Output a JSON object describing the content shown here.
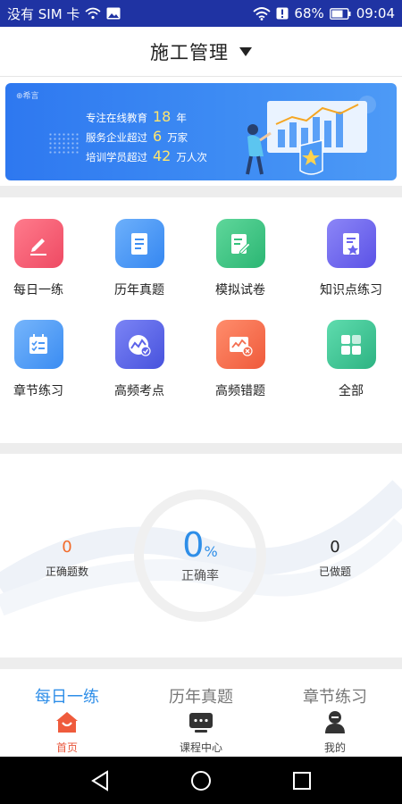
{
  "status_bar": {
    "carrier": "没有 SIM 卡",
    "battery": "68%",
    "time": "09:04"
  },
  "header": {
    "title": "施工管理"
  },
  "banner": {
    "logo_text": "⊕希言",
    "lines": [
      {
        "prefix": "专注在线教育",
        "num": "18",
        "suffix": "年"
      },
      {
        "prefix": "服务企业超过",
        "num": "6",
        "suffix": "万家"
      },
      {
        "prefix": "培训学员超过",
        "num": "42",
        "suffix": "万人次"
      }
    ]
  },
  "grid": [
    {
      "label": "每日一练",
      "icon": "pencil-icon",
      "color": "#f25870"
    },
    {
      "label": "历年真题",
      "icon": "document-icon",
      "color": "#3f92f4"
    },
    {
      "label": "模拟试卷",
      "icon": "paper-edit-icon",
      "color": "#35c27c"
    },
    {
      "label": "知识点练习",
      "icon": "star-note-icon",
      "color": "#6a64ee"
    },
    {
      "label": "章节练习",
      "icon": "checklist-icon",
      "color": "#4a97f5"
    },
    {
      "label": "高频考点",
      "icon": "chart-check-icon",
      "color": "#5c63e9"
    },
    {
      "label": "高频错题",
      "icon": "error-chart-icon",
      "color": "#f36d4f"
    },
    {
      "label": "全部",
      "icon": "grid-icon",
      "color": "#35c490"
    }
  ],
  "stats": {
    "correct_count": "0",
    "correct_count_label": "正确题数",
    "correct_rate": "0",
    "correct_rate_unit": "%",
    "correct_rate_label": "正确率",
    "done_count": "0",
    "done_count_label": "已做题"
  },
  "subtabs": [
    "每日一练",
    "历年真题",
    "章节练习"
  ],
  "bottom_nav": [
    {
      "label": "首页",
      "icon": "home-icon"
    },
    {
      "label": "课程中心",
      "icon": "course-icon"
    },
    {
      "label": "我的",
      "icon": "profile-icon"
    }
  ]
}
